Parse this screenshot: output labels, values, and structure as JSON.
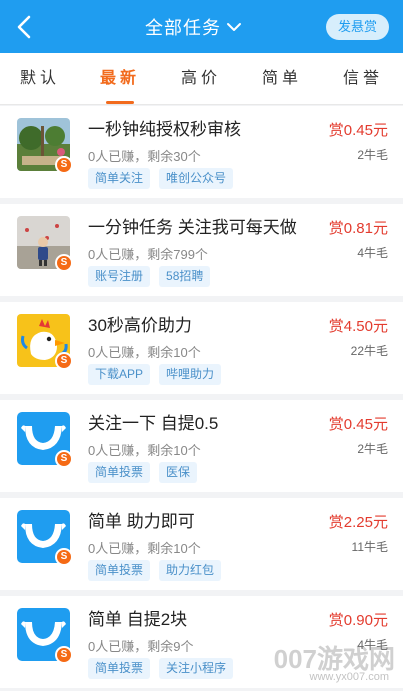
{
  "header": {
    "title": "全部任务",
    "reward_button": "发悬赏",
    "colors": {
      "bar": "#1f9df0",
      "accent": "#f26b1d",
      "price": "#e33b2e"
    }
  },
  "tabs": [
    {
      "label": "默认"
    },
    {
      "label": "最新",
      "active": true
    },
    {
      "label": "高价"
    },
    {
      "label": "简单"
    },
    {
      "label": "信誉"
    }
  ],
  "tasks": [
    {
      "title": "一秒钟纯授权秒审核",
      "meta": "0人已赚，剩余30个",
      "tags": [
        "简单关注",
        "唯创公众号"
      ],
      "price": "赏0.45元",
      "sub": "2牛毛",
      "icon": "garden-photo"
    },
    {
      "title": "一分钟任务 关注我可每天做",
      "meta": "0人已赚，剩余799个",
      "tags": [
        "账号注册",
        "58招聘"
      ],
      "price": "赏0.81元",
      "sub": "4牛毛",
      "icon": "child-photo"
    },
    {
      "title": "30秒高价助力",
      "meta": "0人已赚，剩余10个",
      "tags": [
        "下载APP",
        "哔哩助力"
      ],
      "price": "赏4.50元",
      "sub": "22牛毛",
      "icon": "cartoon-rooster"
    },
    {
      "title": "关注一下 自提0.5",
      "meta": "0人已赚，剩余10个",
      "tags": [
        "简单投票",
        "医保"
      ],
      "price": "赏0.45元",
      "sub": "2牛毛",
      "icon": "blue-app-logo"
    },
    {
      "title": "简单 助力即可",
      "meta": "0人已赚，剩余10个",
      "tags": [
        "简单投票",
        "助力红包"
      ],
      "price": "赏2.25元",
      "sub": "11牛毛",
      "icon": "blue-app-logo"
    },
    {
      "title": "简单 自提2块",
      "meta": "0人已赚，剩余9个",
      "tags": [
        "简单投票",
        "关注小程序"
      ],
      "price": "赏0.90元",
      "sub": "4牛毛",
      "icon": "blue-app-logo"
    }
  ],
  "coin_label": "S",
  "watermark": {
    "big": "007游戏网",
    "small": "www.yx007.com"
  }
}
